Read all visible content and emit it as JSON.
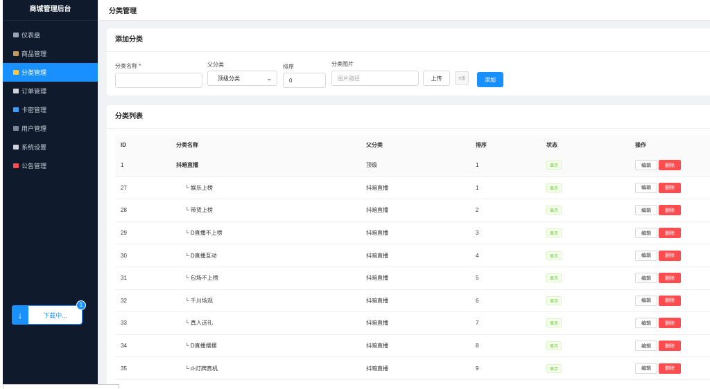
{
  "app": {
    "title": "商城管理后台"
  },
  "sidebar": {
    "items": [
      {
        "label": "仪表盘",
        "icon": "chart-icon",
        "color": "#9aa5b4"
      },
      {
        "label": "商品管理",
        "icon": "box-icon",
        "color": "#c79a5b"
      },
      {
        "label": "分类管理",
        "icon": "folder-icon",
        "color": "#ffc53d",
        "active": true
      },
      {
        "label": "订单管理",
        "icon": "clipboard-icon",
        "color": "#d0d4da"
      },
      {
        "label": "卡密管理",
        "icon": "card-icon",
        "color": "#3aa0ff"
      },
      {
        "label": "用户管理",
        "icon": "users-icon",
        "color": "#7a8797"
      },
      {
        "label": "系统设置",
        "icon": "gear-icon",
        "color": "#d0d4da"
      },
      {
        "label": "公告管理",
        "icon": "megaphone-icon",
        "color": "#ff4d4f"
      }
    ]
  },
  "download": {
    "label": "下载中...",
    "badge": "1"
  },
  "header": {
    "title": "分类管理"
  },
  "add_form": {
    "title": "添加分类",
    "name_label": "分类名称 *",
    "name_value": "",
    "parent_label": "父分类",
    "parent_value": "顶级分类",
    "sort_label": "排序",
    "sort_value": "0",
    "image_label": "分类图片",
    "image_placeholder": "图片路径",
    "upload_label": "上传",
    "thumb_label": "无图",
    "add_label": "添加"
  },
  "list": {
    "title": "分类列表",
    "columns": [
      "ID",
      "分类名称",
      "父分类",
      "排序",
      "状态",
      "操作"
    ],
    "edit_label": "编辑",
    "delete_label": "删除",
    "rows": [
      {
        "id": "1",
        "name": "抖暗直播",
        "parent": "顶级",
        "sort": "1",
        "status": "显示",
        "top": true
      },
      {
        "id": "27",
        "name": "└ 娱乐上榜",
        "parent": "抖暗直播",
        "sort": "1",
        "status": "显示"
      },
      {
        "id": "28",
        "name": "└ 带货上榜",
        "parent": "抖暗直播",
        "sort": "2",
        "status": "显示"
      },
      {
        "id": "29",
        "name": "└ D直播不上榜",
        "parent": "抖暗直播",
        "sort": "3",
        "status": "显示"
      },
      {
        "id": "30",
        "name": "└ D直播互动",
        "parent": "抖暗直播",
        "sort": "4",
        "status": "显示"
      },
      {
        "id": "31",
        "name": "└ 包场不上榜",
        "parent": "抖暗直播",
        "sort": "5",
        "status": "显示"
      },
      {
        "id": "32",
        "name": "└ 千川场观",
        "parent": "抖暗直播",
        "sort": "6",
        "status": "显示"
      },
      {
        "id": "33",
        "name": "└ 真人送礼",
        "parent": "抖暗直播",
        "sort": "7",
        "status": "显示"
      },
      {
        "id": "34",
        "name": "└ D直播摆摆",
        "parent": "抖暗直播",
        "sort": "8",
        "status": "显示"
      },
      {
        "id": "35",
        "name": "└ d-灯牌真机",
        "parent": "抖暗直播",
        "sort": "9",
        "status": "显示"
      }
    ]
  }
}
